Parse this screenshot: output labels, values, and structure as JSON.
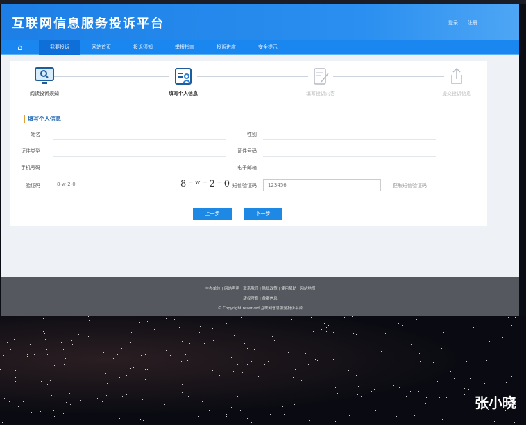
{
  "header": {
    "title": "互联网信息服务投诉平台",
    "links": [
      "登录",
      "注册"
    ]
  },
  "nav": {
    "items": [
      "我要投诉",
      "网站首页",
      "投诉须知",
      "举报指南",
      "投诉进度",
      "安全提示"
    ]
  },
  "steps": [
    "阅读投诉须知",
    "填写个人信息",
    "填写投诉内容",
    "提交投诉信息"
  ],
  "form": {
    "section_title": "填写个人信息",
    "fields": [
      {
        "label": "姓名",
        "value": ""
      },
      {
        "label": "性别",
        "value": ""
      },
      {
        "label": "证件类型",
        "value": ""
      },
      {
        "label": "证件号码",
        "value": ""
      },
      {
        "label": "手机号码",
        "value": ""
      },
      {
        "label": "电子邮箱",
        "value": ""
      }
    ],
    "captcha_label": "验证码",
    "captcha_value": "8-w-2-0",
    "captcha_image": "8⁻ʷ⁻2⁻0",
    "sms_label": "短信验证码",
    "sms_value": "123456",
    "sms_link": "获取短信验证码"
  },
  "buttons": {
    "prev": "上一步",
    "next": "下一步"
  },
  "footer": {
    "lines": [
      "主办单位 | 网站声明 | 联系我们 | 隐私政策 | 使用帮助 | 网站地图",
      "版权所有 | 备案信息",
      "©  Copyright reserved 互联网信息服务投诉平台"
    ]
  },
  "watermark": "张小晓"
}
